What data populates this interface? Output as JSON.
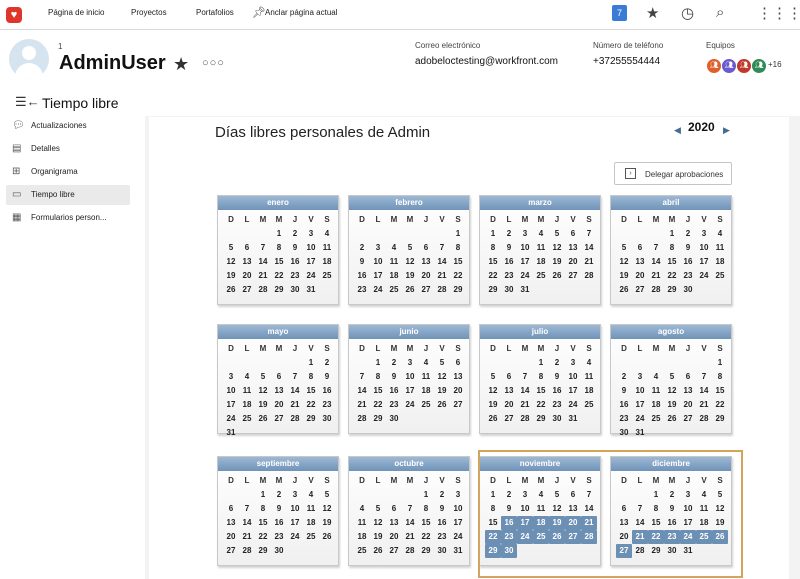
{
  "topnav": {
    "home": "Página de inicio",
    "projects": "Proyectos",
    "portfolios": "Portafolios",
    "pin": "Anclar página actual",
    "notifications": "7"
  },
  "header": {
    "index": "1",
    "name": "AdminUser",
    "email_label": "Correo electrónico",
    "email": "adobeloctesting@workfront.com",
    "phone_label": "Número de teléfono",
    "phone": "+37255554444",
    "teams_label": "Equipos",
    "teams_more": "+16"
  },
  "page": {
    "title": "Tiempo libre"
  },
  "sidebar": {
    "items": [
      {
        "label": "Actualizaciones",
        "icon": "comment-icon"
      },
      {
        "label": "Detalles",
        "icon": "document-icon"
      },
      {
        "label": "Organigrama",
        "icon": "org-chart-icon"
      },
      {
        "label": "Tiempo libre",
        "icon": "calendar-icon"
      },
      {
        "label": "Formularios person...",
        "icon": "form-icon"
      }
    ]
  },
  "calendar": {
    "title": "Días libres personales de Admin",
    "year": "2020",
    "delegate_label": "Delegar aprobaciones",
    "dow": [
      "D",
      "L",
      "M",
      "M",
      "J",
      "V",
      "S"
    ],
    "months": [
      {
        "name": "enero",
        "start": 3,
        "days": 31,
        "off": []
      },
      {
        "name": "febrero",
        "start": 6,
        "days": 29,
        "off": []
      },
      {
        "name": "marzo",
        "start": 0,
        "days": 31,
        "off": []
      },
      {
        "name": "abril",
        "start": 3,
        "days": 30,
        "off": []
      },
      {
        "name": "mayo",
        "start": 5,
        "days": 31,
        "off": []
      },
      {
        "name": "junio",
        "start": 1,
        "days": 30,
        "off": []
      },
      {
        "name": "julio",
        "start": 3,
        "days": 31,
        "off": []
      },
      {
        "name": "agosto",
        "start": 6,
        "days": 31,
        "off": []
      },
      {
        "name": "septiembre",
        "start": 2,
        "days": 30,
        "off": []
      },
      {
        "name": "octubre",
        "start": 4,
        "days": 31,
        "off": []
      },
      {
        "name": "noviembre",
        "start": 0,
        "days": 30,
        "off": [
          16,
          17,
          18,
          19,
          20,
          21,
          22,
          23,
          24,
          25,
          26,
          27,
          28,
          29,
          30
        ]
      },
      {
        "name": "diciembre",
        "start": 2,
        "days": 31,
        "off": [
          21,
          22,
          23,
          24,
          25,
          26,
          27
        ]
      }
    ]
  },
  "colors": {
    "accent": "#6c8fb4",
    "highlight": "#d4a45c",
    "brand": "#e0352b"
  }
}
